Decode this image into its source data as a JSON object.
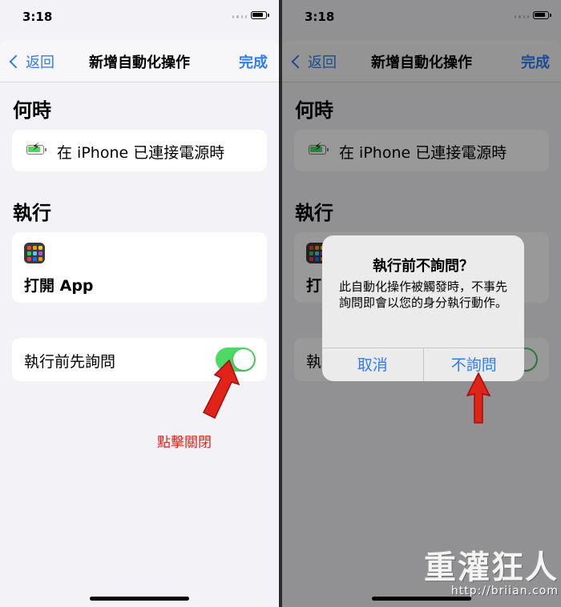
{
  "status": {
    "time": "3:18"
  },
  "nav": {
    "back": "返回",
    "title": "新增自動化操作",
    "done": "完成"
  },
  "when": {
    "heading": "何時",
    "trigger": "在 iPhone 已連接電源時"
  },
  "do": {
    "heading": "執行",
    "action": "打開 App"
  },
  "ask": {
    "label": "執行前先詢問",
    "toggle_on": true
  },
  "annotation": {
    "hint": "點擊關閉"
  },
  "alert": {
    "title": "執行前不詢問？",
    "message": "此自動化操作被觸發時，不事先詢問即會以您的身分執行動作。",
    "cancel": "取消",
    "confirm": "不詢問"
  },
  "watermark": {
    "brand": "重灌狂人",
    "url": "http://briian.com"
  },
  "colors": {
    "accent": "#2f7cf6",
    "toggle": "#4cd964",
    "annotation": "#e2231a"
  },
  "icons": [
    "back-chevron-icon",
    "battery-charging-icon",
    "app-grid-icon",
    "red-arrow-icon"
  ]
}
